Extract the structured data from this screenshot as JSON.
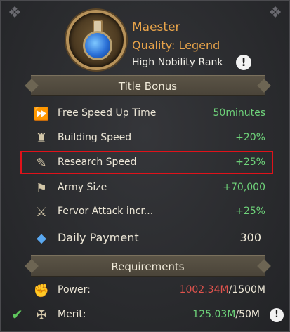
{
  "header": {
    "name": "Maester",
    "quality": "Quality: Legend",
    "rank": "High Nobility Rank",
    "info_glyph": "!"
  },
  "icons": {
    "badge": "potion-flask-icon",
    "speedup": "fast-forward-free-icon",
    "building": "castle-tower-icon",
    "research": "scroll-clock-icon",
    "army": "army-banner-icon",
    "fervor": "crossed-swords-icon",
    "payment": "blue-crystal-icon",
    "power": "fist-icon",
    "merit": "merit-medal-icon",
    "check": "check-icon"
  },
  "sections": {
    "bonus_title": "Title Bonus",
    "requirements_title": "Requirements"
  },
  "bonuses": [
    {
      "label": "Free Speed Up Time",
      "value": "50minutes"
    },
    {
      "label": "Building Speed",
      "value": "+20%"
    },
    {
      "label": "Research Speed",
      "value": "+25%"
    },
    {
      "label": "Army Size",
      "value": "+70,000"
    },
    {
      "label": "Fervor Attack incr...",
      "value": "+25%"
    }
  ],
  "payment": {
    "label": "Daily Payment",
    "value": "300"
  },
  "requirements": {
    "power": {
      "label": "Power:",
      "current": "1002.34M",
      "sep": "/",
      "target": "1500M"
    },
    "merit": {
      "label": "Merit:",
      "current": "125.03M",
      "sep": "/",
      "target": "50M"
    }
  },
  "colors": {
    "accent_orange": "#e7a34a",
    "positive_green": "#6ed37a",
    "deficit_red": "#e0534d",
    "highlight_red": "#e0121a"
  }
}
